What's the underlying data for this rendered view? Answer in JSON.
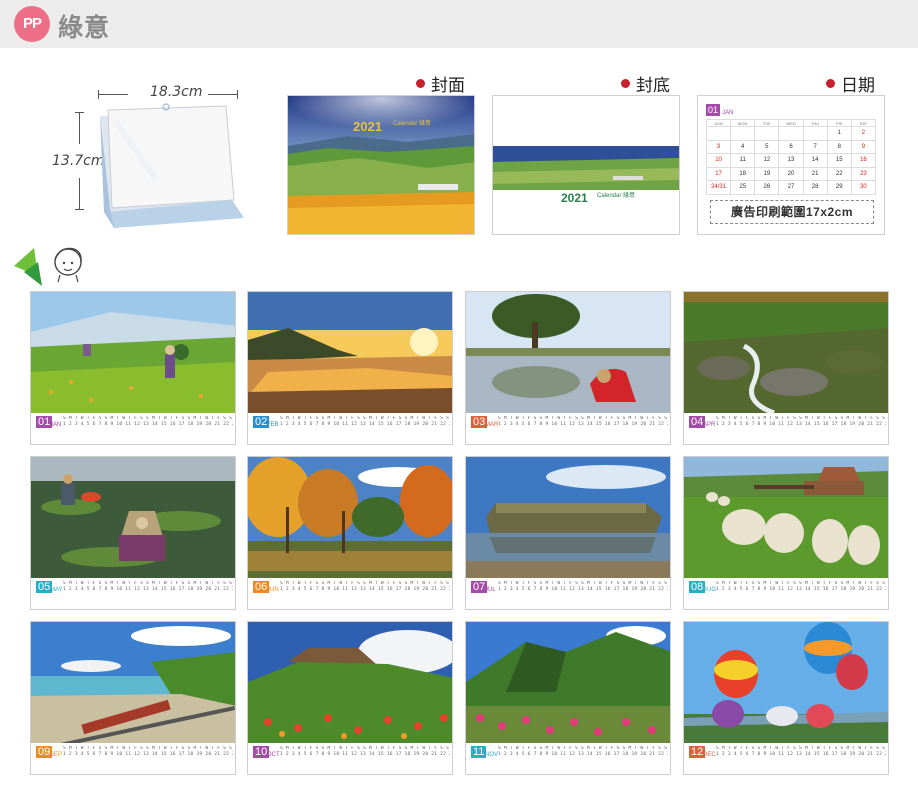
{
  "header": {
    "badge": "PP",
    "brand": "綠意"
  },
  "size": {
    "width_label": "18.3cm",
    "height_label": "13.7cm"
  },
  "previews": {
    "cover": {
      "label": "封面",
      "title": "2021",
      "subtitle": "Calendar 綠意"
    },
    "back": {
      "label": "封底",
      "title": "2021",
      "subtitle": "Calendar 綠意"
    },
    "date": {
      "label": "日期",
      "month_num": "01",
      "month_name": "JAN",
      "weekdays": [
        "SUN",
        "MON",
        "TUE",
        "WED",
        "THU",
        "FRI",
        "SAT"
      ],
      "days": [
        "",
        "",
        "",
        "",
        "",
        "1",
        "2",
        "3",
        "4",
        "5",
        "6",
        "7",
        "8",
        "9",
        "10",
        "11",
        "12",
        "13",
        "14",
        "15",
        "16",
        "17",
        "18",
        "19",
        "20",
        "21",
        "22",
        "23",
        "24/31",
        "25",
        "26",
        "27",
        "28",
        "29",
        "30"
      ],
      "ad_text": "廣告印刷範圍17x2cm"
    }
  },
  "months": [
    {
      "num": "01",
      "abbr": "JAN",
      "color": "#a44aa8"
    },
    {
      "num": "02",
      "abbr": "FEB",
      "color": "#2a8fd0"
    },
    {
      "num": "03",
      "abbr": "MAR",
      "color": "#e0603a"
    },
    {
      "num": "04",
      "abbr": "APR",
      "color": "#a44aa8"
    },
    {
      "num": "05",
      "abbr": "MAY",
      "color": "#2aaec8"
    },
    {
      "num": "06",
      "abbr": "JUN",
      "color": "#f08a1c"
    },
    {
      "num": "07",
      "abbr": "JUL",
      "color": "#a44aa8"
    },
    {
      "num": "08",
      "abbr": "AUG",
      "color": "#2aaec8"
    },
    {
      "num": "09",
      "abbr": "SEP",
      "color": "#f08a1c"
    },
    {
      "num": "10",
      "abbr": "OCT",
      "color": "#a44aa8"
    },
    {
      "num": "11",
      "abbr": "NOV",
      "color": "#2aaec8"
    },
    {
      "num": "12",
      "abbr": "DEC",
      "color": "#e0603a"
    }
  ]
}
